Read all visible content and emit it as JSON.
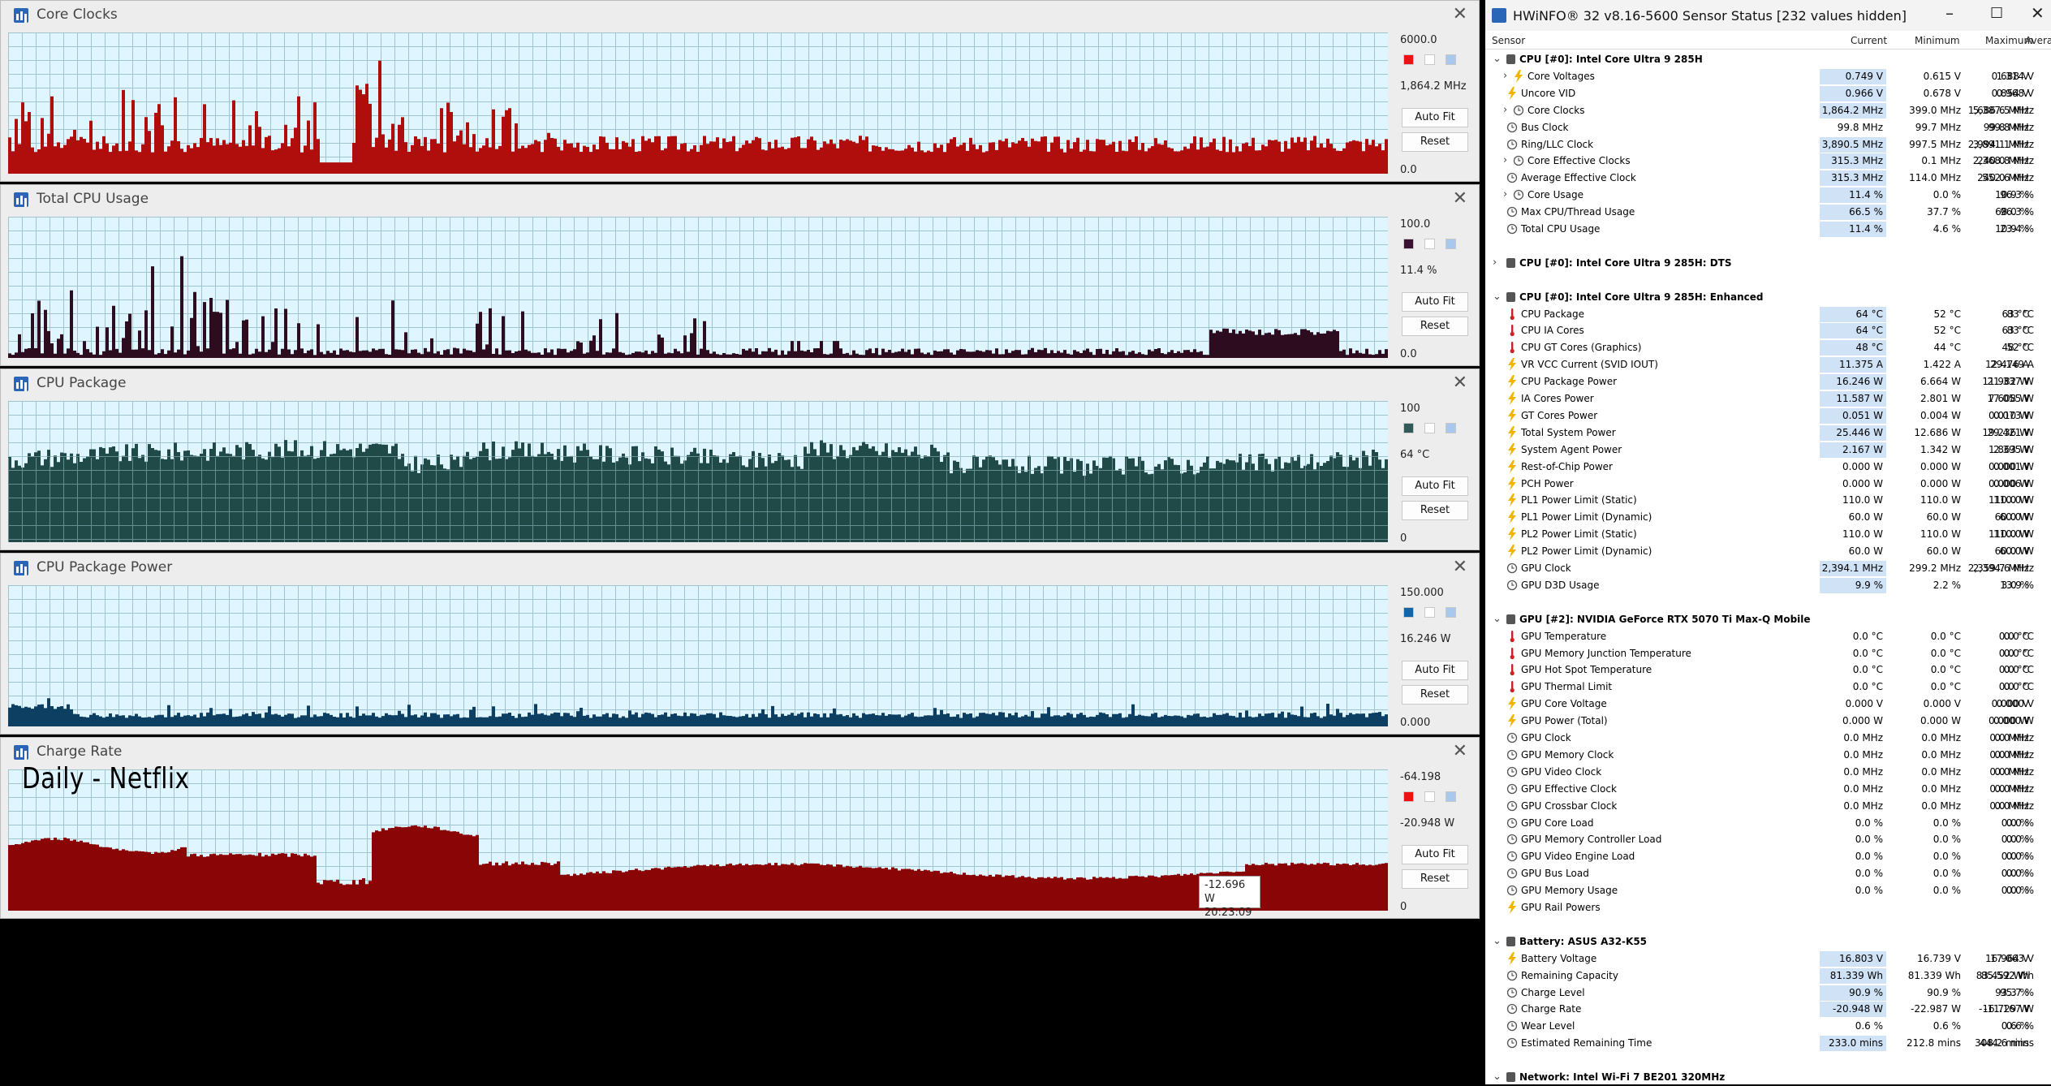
{
  "graphs": [
    {
      "title": "Core Clocks",
      "max": "6000.0",
      "current": "1,864.2 MHz",
      "min": "0.0",
      "color": "#b00d0d",
      "swatch": "#ee1111",
      "kind": "clocks"
    },
    {
      "title": "Total CPU Usage",
      "max": "100.0",
      "current": "11.4 %",
      "min": "0.0",
      "color": "#2c0c1e",
      "swatch": "#3a1030",
      "kind": "usage"
    },
    {
      "title": "CPU Package",
      "max": "100",
      "current": "64 °C",
      "min": "0",
      "color": "#1f4a48",
      "swatch": "#2f5a58",
      "kind": "temp"
    },
    {
      "title": "CPU Package Power",
      "max": "150.000",
      "current": "16.246 W",
      "min": "0.000",
      "color": "#0c3f62",
      "swatch": "#1464a6",
      "kind": "power"
    },
    {
      "title": "Charge Rate",
      "max": "-64.198",
      "current": "-20.948 W",
      "min": "0",
      "color": "#8a0606",
      "swatch": "#ee1111",
      "kind": "charge"
    }
  ],
  "buttons": {
    "auto_fit": "Auto Fit",
    "reset": "Reset"
  },
  "overlay": {
    "label": "Daily - Netflix"
  },
  "tooltip": {
    "value": "-12.696 W",
    "time": "20:23:09"
  },
  "hwinfo": {
    "title": "HWiNFO® 32 v8.16-5600 Sensor Status [232 values hidden]",
    "columns": {
      "sensor": "Sensor",
      "current": "Current",
      "minimum": "Minimum",
      "maximum": "Maximum",
      "average": "Average"
    },
    "rows": [
      {
        "t": "group",
        "name": "CPU [#0]: Intel Core Ultra 9 285H",
        "open": true
      },
      {
        "t": "item",
        "icon": "bolt",
        "exp": true,
        "name": "Core Voltages",
        "cur": "0.749 V",
        "min": "0.615 V",
        "max": "1.314 V",
        "avg": "0.688 V",
        "hl": true
      },
      {
        "t": "item",
        "icon": "bolt",
        "name": "Uncore VID",
        "cur": "0.966 V",
        "min": "0.678 V",
        "max": "0.968 V",
        "avg": "0.854 V",
        "hl": true
      },
      {
        "t": "item",
        "icon": "clock",
        "exp": true,
        "name": "Core Clocks",
        "cur": "1,864.2 MHz",
        "min": "399.0 MHz",
        "max": "5,387.5 MHz",
        "avg": "1,686.6 MHz",
        "hl": true
      },
      {
        "t": "item",
        "icon": "clock",
        "name": "Bus Clock",
        "cur": "99.8 MHz",
        "min": "99.7 MHz",
        "max": "99.8 MHz",
        "avg": "99.8 MHz",
        "hl": false
      },
      {
        "t": "item",
        "icon": "clock",
        "name": "Ring/LLC Clock",
        "cur": "3,890.5 MHz",
        "min": "997.5 MHz",
        "max": "3,891.1 MHz",
        "avg": "2,994.1 MHz",
        "hl": true
      },
      {
        "t": "item",
        "icon": "clock",
        "exp": true,
        "name": "Core Effective Clocks",
        "cur": "315.3 MHz",
        "min": "0.1 MHz",
        "max": "2,368.8 MHz",
        "avg": "240.0 MHz",
        "hl": true
      },
      {
        "t": "item",
        "icon": "clock",
        "name": "Average Effective Clock",
        "cur": "315.3 MHz",
        "min": "114.0 MHz",
        "max": "552.6 MHz",
        "avg": "240.0 MHz",
        "hl": true
      },
      {
        "t": "item",
        "icon": "clock",
        "exp": true,
        "name": "Core Usage",
        "cur": "11.4 %",
        "min": "0.0 %",
        "max": "96.3 %",
        "avg": "10.9 %",
        "hl": true
      },
      {
        "t": "item",
        "icon": "clock",
        "name": "Max CPU/Thread Usage",
        "cur": "66.5 %",
        "min": "37.7 %",
        "max": "96.3 %",
        "avg": "68.0 %",
        "hl": true
      },
      {
        "t": "item",
        "icon": "clock",
        "name": "Total CPU Usage",
        "cur": "11.4 %",
        "min": "4.6 %",
        "max": "23.4 %",
        "avg": "10.9 %",
        "hl": true
      },
      {
        "t": "blank"
      },
      {
        "t": "group",
        "name": "CPU [#0]: Intel Core Ultra 9 285H: DTS",
        "open": false
      },
      {
        "t": "blank"
      },
      {
        "t": "group",
        "name": "CPU [#0]: Intel Core Ultra 9 285H: Enhanced",
        "open": true
      },
      {
        "t": "item",
        "icon": "therm",
        "name": "CPU Package",
        "cur": "64 °C",
        "min": "52 °C",
        "max": "83 °C",
        "avg": "63 °C",
        "hl": true
      },
      {
        "t": "item",
        "icon": "therm",
        "name": "CPU IA Cores",
        "cur": "64 °C",
        "min": "52 °C",
        "max": "83 °C",
        "avg": "63 °C",
        "hl": true
      },
      {
        "t": "item",
        "icon": "therm",
        "name": "CPU GT Cores (Graphics)",
        "cur": "48 °C",
        "min": "44 °C",
        "max": "52 °C",
        "avg": "48 °C",
        "hl": true
      },
      {
        "t": "item",
        "icon": "bolt",
        "name": "VR VCC Current (SVID IOUT)",
        "cur": "11.375 A",
        "min": "1.422 A",
        "max": "29.149 A",
        "avg": "12.476 A",
        "hl": true
      },
      {
        "t": "item",
        "icon": "bolt",
        "name": "CPU Package Power",
        "cur": "16.246 W",
        "min": "6.664 W",
        "max": "21.337 W",
        "avg": "11.982 W",
        "hl": true
      },
      {
        "t": "item",
        "icon": "bolt",
        "name": "IA Cores Power",
        "cur": "11.587 W",
        "min": "2.801 W",
        "max": "17.055 W",
        "avg": "7.608 W",
        "hl": true
      },
      {
        "t": "item",
        "icon": "bolt",
        "name": "GT Cores Power",
        "cur": "0.051 W",
        "min": "0.004 W",
        "max": "0.073 W",
        "avg": "0.010 W",
        "hl": true
      },
      {
        "t": "item",
        "icon": "bolt",
        "name": "Total System Power",
        "cur": "25.446 W",
        "min": "12.686 W",
        "max": "29.421 W",
        "avg": "19.236 W",
        "hl": true
      },
      {
        "t": "item",
        "icon": "bolt",
        "name": "System Agent Power",
        "cur": "2.167 W",
        "min": "1.342 W",
        "max": "2.395 W",
        "avg": "1.863 W",
        "hl": true
      },
      {
        "t": "item",
        "icon": "bolt",
        "name": "Rest-of-Chip Power",
        "cur": "0.000 W",
        "min": "0.000 W",
        "max": "0.001 W",
        "avg": "0.000 W",
        "hl": false
      },
      {
        "t": "item",
        "icon": "bolt",
        "name": "PCH Power",
        "cur": "0.000 W",
        "min": "0.000 W",
        "max": "0.006 W",
        "avg": "0.000 W",
        "hl": false
      },
      {
        "t": "item",
        "icon": "bolt",
        "name": "PL1 Power Limit (Static)",
        "cur": "110.0 W",
        "min": "110.0 W",
        "max": "110.0 W",
        "avg": "110.0 W",
        "hl": false
      },
      {
        "t": "item",
        "icon": "bolt",
        "name": "PL1 Power Limit (Dynamic)",
        "cur": "60.0 W",
        "min": "60.0 W",
        "max": "60.0 W",
        "avg": "60.0 W",
        "hl": false
      },
      {
        "t": "item",
        "icon": "bolt",
        "name": "PL2 Power Limit (Static)",
        "cur": "110.0 W",
        "min": "110.0 W",
        "max": "110.0 W",
        "avg": "110.0 W",
        "hl": false
      },
      {
        "t": "item",
        "icon": "bolt",
        "name": "PL2 Power Limit (Dynamic)",
        "cur": "60.0 W",
        "min": "60.0 W",
        "max": "60.0 W",
        "avg": "60.0 W",
        "hl": false
      },
      {
        "t": "item",
        "icon": "clock",
        "name": "GPU Clock",
        "cur": "2,394.1 MHz",
        "min": "299.2 MHz",
        "max": "2,394.6 MHz",
        "avg": "2,359.7 MHz",
        "hl": true
      },
      {
        "t": "item",
        "icon": "clock",
        "name": "GPU D3D Usage",
        "cur": "9.9 %",
        "min": "2.2 %",
        "max": "13.9 %",
        "avg": "3.0 %",
        "hl": true
      },
      {
        "t": "blank"
      },
      {
        "t": "group",
        "name": "GPU [#2]: NVIDIA  GeForce RTX 5070 Ti Max-Q Mobile",
        "open": true
      },
      {
        "t": "item",
        "icon": "therm",
        "name": "GPU Temperature",
        "cur": "0.0 °C",
        "min": "0.0 °C",
        "max": "0.0 °C",
        "avg": "0.0 °C",
        "hl": false
      },
      {
        "t": "item",
        "icon": "therm",
        "name": "GPU Memory Junction Temperature",
        "cur": "0.0 °C",
        "min": "0.0 °C",
        "max": "0.0 °C",
        "avg": "0.0 °C",
        "hl": false
      },
      {
        "t": "item",
        "icon": "therm",
        "name": "GPU Hot Spot Temperature",
        "cur": "0.0 °C",
        "min": "0.0 °C",
        "max": "0.0 °C",
        "avg": "0.0 °C",
        "hl": false
      },
      {
        "t": "item",
        "icon": "therm",
        "name": "GPU Thermal Limit",
        "cur": "0.0 °C",
        "min": "0.0 °C",
        "max": "0.0 °C",
        "avg": "0.0 °C",
        "hl": false
      },
      {
        "t": "item",
        "icon": "bolt",
        "name": "GPU Core Voltage",
        "cur": "0.000 V",
        "min": "0.000 V",
        "max": "0.000 V",
        "avg": "0.000 V",
        "hl": false
      },
      {
        "t": "item",
        "icon": "bolt",
        "name": "GPU Power (Total)",
        "cur": "0.000 W",
        "min": "0.000 W",
        "max": "0.000 W",
        "avg": "0.000 W",
        "hl": false
      },
      {
        "t": "item",
        "icon": "clock",
        "name": "GPU Clock",
        "cur": "0.0 MHz",
        "min": "0.0 MHz",
        "max": "0.0 MHz",
        "avg": "0.0 MHz",
        "hl": false
      },
      {
        "t": "item",
        "icon": "clock",
        "name": "GPU Memory Clock",
        "cur": "0.0 MHz",
        "min": "0.0 MHz",
        "max": "0.0 MHz",
        "avg": "0.0 MHz",
        "hl": false
      },
      {
        "t": "item",
        "icon": "clock",
        "name": "GPU Video Clock",
        "cur": "0.0 MHz",
        "min": "0.0 MHz",
        "max": "0.0 MHz",
        "avg": "0.0 MHz",
        "hl": false
      },
      {
        "t": "item",
        "icon": "clock",
        "name": "GPU Effective Clock",
        "cur": "0.0 MHz",
        "min": "0.0 MHz",
        "max": "0.0 MHz",
        "avg": "0.0 MHz",
        "hl": false
      },
      {
        "t": "item",
        "icon": "clock",
        "name": "GPU Crossbar Clock",
        "cur": "0.0 MHz",
        "min": "0.0 MHz",
        "max": "0.0 MHz",
        "avg": "0.0 MHz",
        "hl": false
      },
      {
        "t": "item",
        "icon": "clock",
        "name": "GPU Core Load",
        "cur": "0.0 %",
        "min": "0.0 %",
        "max": "0.0 %",
        "avg": "0.0 %",
        "hl": false
      },
      {
        "t": "item",
        "icon": "clock",
        "name": "GPU Memory Controller Load",
        "cur": "0.0 %",
        "min": "0.0 %",
        "max": "0.0 %",
        "avg": "0.0 %",
        "hl": false
      },
      {
        "t": "item",
        "icon": "clock",
        "name": "GPU Video Engine Load",
        "cur": "0.0 %",
        "min": "0.0 %",
        "max": "0.0 %",
        "avg": "0.0 %",
        "hl": false
      },
      {
        "t": "item",
        "icon": "clock",
        "name": "GPU Bus Load",
        "cur": "0.0 %",
        "min": "0.0 %",
        "max": "0.0 %",
        "avg": "0.0 %",
        "hl": false
      },
      {
        "t": "item",
        "icon": "clock",
        "name": "GPU Memory Usage",
        "cur": "0.0 %",
        "min": "0.0 %",
        "max": "0.0 %",
        "avg": "0.0 %",
        "hl": false
      },
      {
        "t": "item",
        "icon": "bolt",
        "name": "GPU Rail Powers",
        "cur": "",
        "min": "",
        "max": "",
        "avg": "",
        "hl": false
      },
      {
        "t": "blank"
      },
      {
        "t": "group",
        "name": "Battery: ASUS  A32-K55",
        "open": true
      },
      {
        "t": "item",
        "icon": "bolt",
        "name": "Battery Voltage",
        "cur": "16.803 V",
        "min": "16.739 V",
        "max": "17.063 V",
        "avg": "16.964 V",
        "hl": true
      },
      {
        "t": "item",
        "icon": "clock",
        "name": "Remaining Capacity",
        "cur": "81.339 Wh",
        "min": "81.339 Wh",
        "max": "85.592 Wh",
        "avg": "83.452 Wh",
        "hl": true
      },
      {
        "t": "item",
        "icon": "clock",
        "name": "Charge Level",
        "cur": "90.9 %",
        "min": "90.9 %",
        "max": "95.7 %",
        "avg": "93.3 %",
        "hl": true
      },
      {
        "t": "item",
        "icon": "clock",
        "name": "Charge Rate",
        "cur": "-20.948 W",
        "min": "-22.987 W",
        "max": "-11.167 W",
        "avg": "-16.729 W",
        "hl": true
      },
      {
        "t": "item",
        "icon": "clock",
        "name": "Wear Level",
        "cur": "0.6 %",
        "min": "0.6 %",
        "max": "0.6 %",
        "avg": "0.6 %",
        "hl": false
      },
      {
        "t": "item",
        "icon": "clock",
        "name": "Estimated Remaining Time",
        "cur": "233.0 mins",
        "min": "212.8 mins",
        "max": "444.6 mins",
        "avg": "308.2 mins",
        "hl": true
      },
      {
        "t": "blank"
      },
      {
        "t": "group",
        "name": "Network: Intel Wi-Fi 7 BE201 320MHz",
        "open": true
      }
    ]
  }
}
